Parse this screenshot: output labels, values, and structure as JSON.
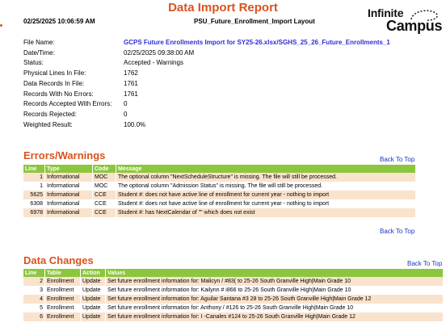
{
  "header": {
    "title": "Data Import Report",
    "timestamp": "02/25/2025 10:06:59 AM",
    "layout_name": "PSU_Future_Enrollment_Import Layout",
    "logo_line1": "Infinite",
    "logo_line2": "Campus"
  },
  "summary": [
    {
      "label": "File Name:",
      "value": "GCPS Future Enrollments Import for SY25-26.xlsx/SGHS_25_26_Future_Enrollments_1",
      "link": true
    },
    {
      "label": "Date/Time:",
      "value": "02/25/2025 09:38:00 AM"
    },
    {
      "label": "Status:",
      "value": "Accepted - Warnings"
    },
    {
      "label": "Physical Lines In File:",
      "value": "1762"
    },
    {
      "label": "Data Records In File:",
      "value": "1761"
    },
    {
      "label": "Records With No Errors:",
      "value": "1761"
    },
    {
      "label": "Records Accepted With Errors:",
      "value": "0"
    },
    {
      "label": "Records Rejected:",
      "value": "0"
    },
    {
      "label": "Weighted Result:",
      "value": "100.0%"
    }
  ],
  "errors": {
    "heading": "Errors/Warnings",
    "back_to_top": "Back To Top",
    "back_to_top_bottom": "Back To Top",
    "columns": [
      "Line",
      "Type",
      "Code",
      "Message"
    ],
    "rows": [
      {
        "line": "1",
        "type": "Informational",
        "code": "MOC",
        "message": "The optional column \"NextScheduleStructure\" is missing. The file will still be processed."
      },
      {
        "line": "1",
        "type": "Informational",
        "code": "MOC",
        "message": "The optional column \"Admission Status\" is missing. The file will still be processed."
      },
      {
        "line": "5625",
        "type": "Informational",
        "code": "CCE",
        "message": "Student #:                      does not have active line of enrollment for current year - nothing to import"
      },
      {
        "line": "6308",
        "type": "Informational",
        "code": "CCE",
        "message": "Student #:                     does not have active line of enrollment for current year - nothing to import"
      },
      {
        "line": "6978",
        "type": "Informational",
        "code": "CCE",
        "message": "Student #:                     has NextCalendar of \"\" which does not exist"
      }
    ]
  },
  "changes": {
    "heading": "Data Changes",
    "back_to_top": "Back To Top",
    "columns": [
      "Line",
      "Table",
      "Action",
      "Values"
    ],
    "rows": [
      {
        "line": "2",
        "table": "Enrollment",
        "action": "Update",
        "values": "Set future enrollment information for: Malicyn /          #83(          to 25-26 South Granville High|Main Grade 10"
      },
      {
        "line": "3",
        "table": "Enrollment",
        "action": "Update",
        "values": "Set future enrollment information for: Kailynn                #            i866 to 25-26 South Granville High|Main Grade 10"
      },
      {
        "line": "4",
        "table": "Enrollment",
        "action": "Update",
        "values": "Set future enrollment information for:           Aguilar Santana #3        28 to 25-26 South Granville High|Main Grade 12"
      },
      {
        "line": "5",
        "table": "Enrollment",
        "action": "Update",
        "values": "Set future enrollment information for: Anthony /              #126        to 25-26 South Granville High|Main Grade 10"
      },
      {
        "line": "6",
        "table": "Enrollment",
        "action": "Update",
        "values": "Set future enrollment information for: I                  -Canales #124          to 25-26 South Granville High|Main Grade 12"
      }
    ]
  }
}
